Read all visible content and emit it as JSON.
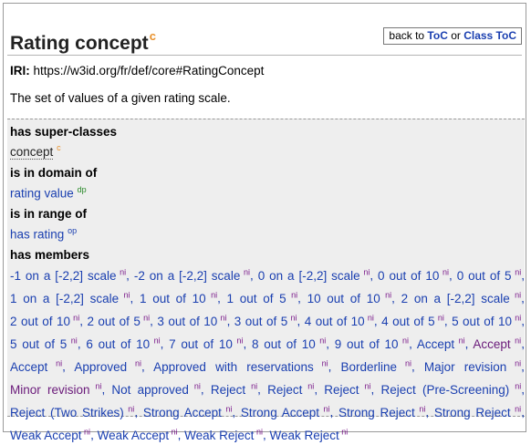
{
  "header": {
    "title": "Rating concept",
    "title_badge": "c",
    "back_prefix": "back to ",
    "toc_link": "ToC",
    "or_text": " or ",
    "class_toc_link": "Class ToC"
  },
  "iri": {
    "label": "IRI:",
    "value": "https://w3id.org/fr/def/core#RatingConcept"
  },
  "comment": "The set of values of a given rating scale.",
  "sections": {
    "super_classes": {
      "heading": "has super-classes",
      "item": "concept",
      "badge": "c"
    },
    "domain_of": {
      "heading": "is in domain of",
      "item": "rating value",
      "badge": "dp"
    },
    "range_of": {
      "heading": "is in range of",
      "item": "has rating",
      "badge": "op"
    },
    "members": {
      "heading": "has members",
      "badge": "ni",
      "items": [
        "-1 on a [-2,2] scale",
        "-2 on a [-2,2] scale",
        "0 on a [-2,2] scale",
        "0 out of 10",
        "0 out of 5",
        "1 on a [-2,2] scale",
        "1 out of 10",
        "1 out of 5",
        "10 out of 10",
        "2 on a [-2,2] scale",
        "2 out of 10",
        "2 out of 5",
        "3 out of 10",
        "3 out of 5",
        "4 out of 10",
        "4 out of 5",
        "5 out of 10",
        "5 out of 5",
        "6 out of 10",
        "7 out of 10",
        "8 out of 10",
        "9 out of 10",
        "Accept",
        "Accept",
        "Accept",
        "Approved",
        "Approved with reservations",
        "Borderline",
        "Major revision",
        "Minor revision",
        "Not approved",
        "Reject",
        "Reject",
        "Reject",
        "Reject (Pre-Screening)",
        "Reject (Two Strikes)",
        "Strong Accept",
        "Strong Accept",
        "Strong Reject",
        "Strong Reject",
        "Weak Accept",
        "Weak Accept",
        "Weak Reject",
        "Weak Reject"
      ]
    }
  },
  "colors": {
    "link": "#1a3fb0",
    "visited_link": "#6a1a7a",
    "class_badge": "#e8902a",
    "dp_badge": "#2a8a2a"
  }
}
